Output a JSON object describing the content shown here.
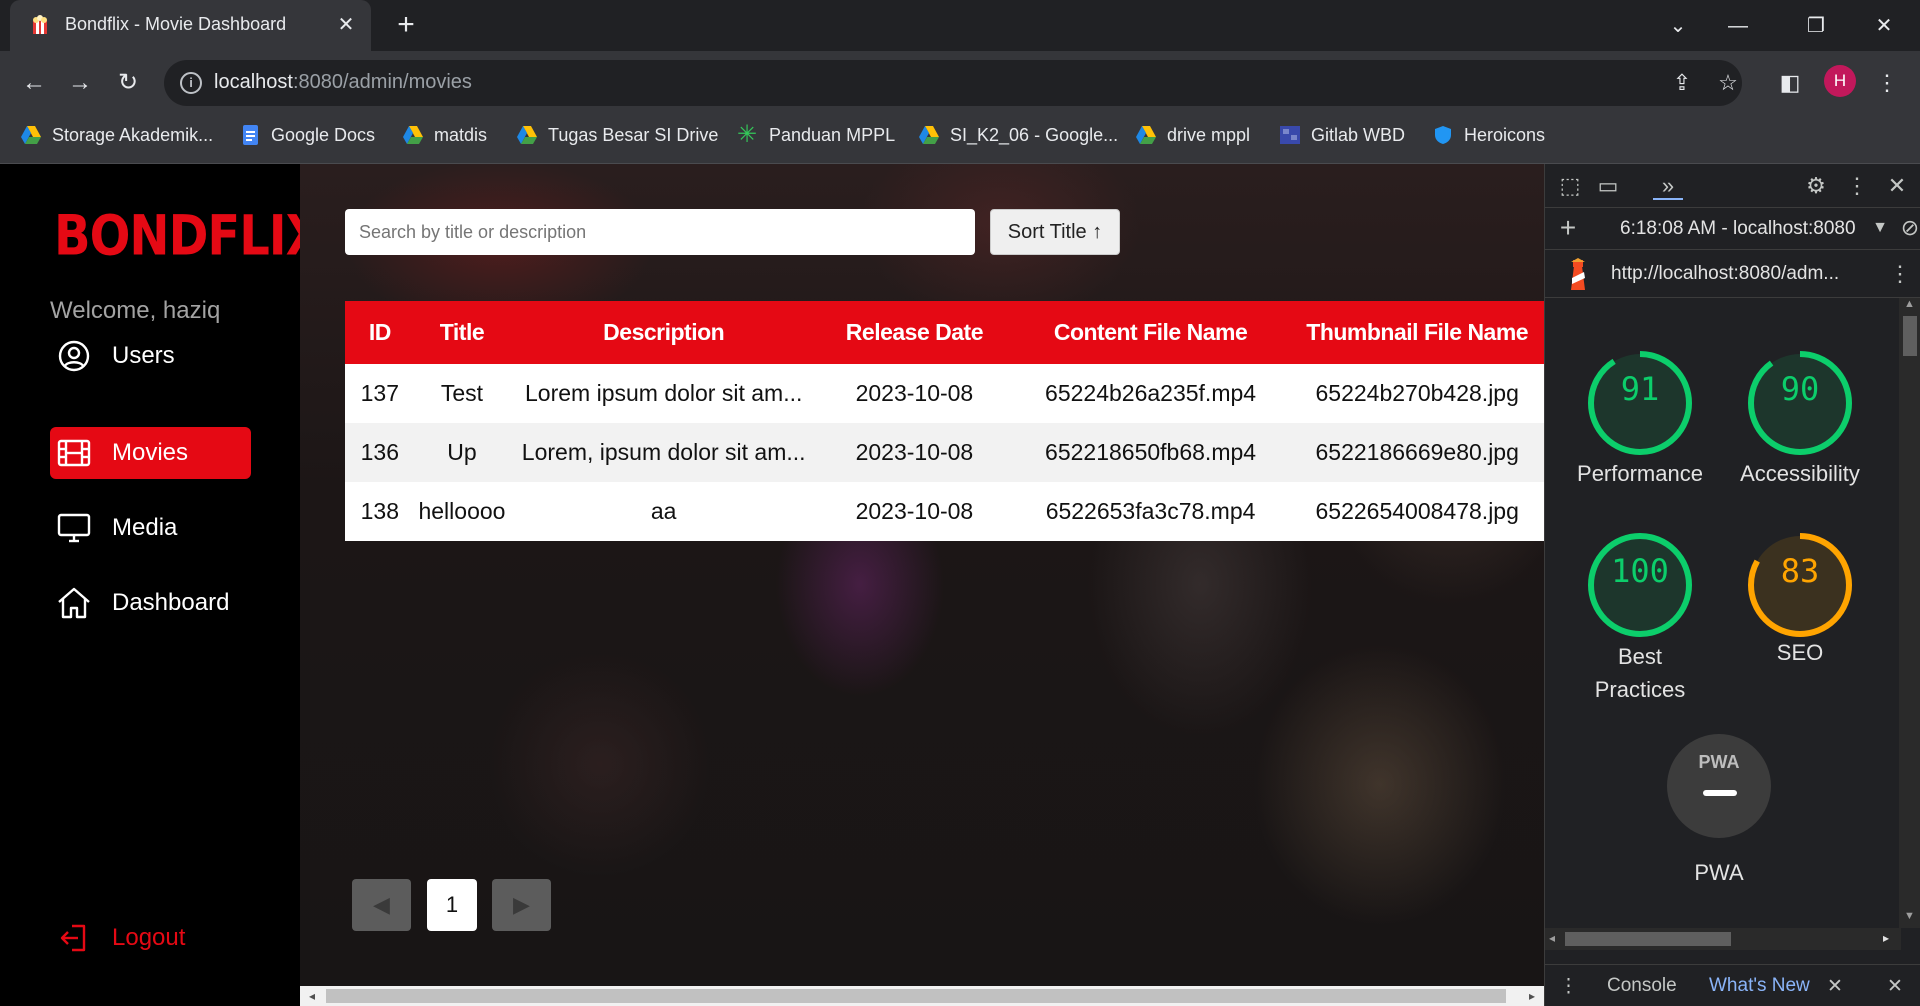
{
  "browser": {
    "tab_title": "Bondflix - Movie Dashboard",
    "url_host": "localhost",
    "url_path": ":8080/admin/movies",
    "profile_initial": "H",
    "bookmarks": [
      {
        "label": "Storage Akademik...",
        "icon": "google-drive-icon"
      },
      {
        "label": "Google Docs",
        "icon": "google-docs-icon"
      },
      {
        "label": "matdis",
        "icon": "google-drive-icon"
      },
      {
        "label": "Tugas Besar SI Drive",
        "icon": "google-drive-icon"
      },
      {
        "label": "Panduan MPPL",
        "icon": "green-star-icon"
      },
      {
        "label": "SI_K2_06 - Google...",
        "icon": "google-drive-icon"
      },
      {
        "label": "drive mppl",
        "icon": "google-drive-icon"
      },
      {
        "label": "Gitlab WBD",
        "icon": "gitlab-icon"
      },
      {
        "label": "Heroicons",
        "icon": "shield-icon"
      }
    ]
  },
  "sidebar": {
    "logo": "BONDFLIX",
    "welcome": "Welcome, haziq",
    "items": [
      {
        "label": "Users",
        "icon": "user-circle-icon"
      },
      {
        "label": "Movies",
        "icon": "film-icon"
      },
      {
        "label": "Media",
        "icon": "monitor-icon"
      },
      {
        "label": "Dashboard",
        "icon": "home-icon"
      }
    ],
    "logout": "Logout"
  },
  "main": {
    "search_placeholder": "Search by title or description",
    "sort_label": "Sort Title ↑",
    "columns": [
      "ID",
      "Title",
      "Description",
      "Release Date",
      "Content File Name",
      "Thumbnail File Name"
    ],
    "rows": [
      [
        "137",
        "Test",
        "Lorem ipsum dolor sit am...",
        "2023-10-08",
        "65224b26a235f.mp4",
        "65224b270b428.jpg"
      ],
      [
        "136",
        "Up",
        "Lorem, ipsum dolor sit am...",
        "2023-10-08",
        "652218650fb68.mp4",
        "6522186669e80.jpg"
      ],
      [
        "138",
        "helloooo",
        "aa",
        "2023-10-08",
        "6522653fa3c78.mp4",
        "6522654008478.jpg"
      ]
    ],
    "pagination": {
      "prev": "◀",
      "page": "1",
      "next": "▶"
    }
  },
  "devtools": {
    "time_host": "6:18:08 AM - localhost:8080",
    "report_url": "http://localhost:8080/adm...",
    "scores": [
      {
        "value": "91",
        "label": "Performance",
        "color": "#0cce6b"
      },
      {
        "value": "90",
        "label": "Accessibility",
        "color": "#0cce6b"
      },
      {
        "value": "100",
        "label": "Best Practices",
        "color": "#0cce6b"
      },
      {
        "value": "83",
        "label": "SEO",
        "color": "#ffa400"
      }
    ],
    "pwa_badge": "PWA",
    "pwa_label": "PWA",
    "bottom_tabs": {
      "console": "Console",
      "whats_new": "What's New"
    }
  },
  "colors": {
    "brand": "#e50914",
    "pass": "#0cce6b",
    "average": "#ffa400"
  }
}
